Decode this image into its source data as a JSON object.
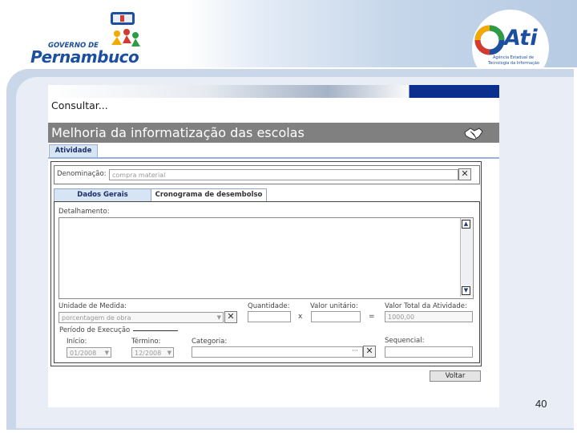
{
  "slide": {
    "page_number": "40",
    "logo_left": {
      "top_text": "GOVERNO DE",
      "main_text": "Pernambuco"
    },
    "logo_right": {
      "main_text": "Ati",
      "line1": "Agência Estadual de",
      "line2": "Tecnologia da Informação"
    }
  },
  "app": {
    "heading": "Consultar...",
    "title": "Melhoria da informatização das escolas",
    "tab_main": "Atividade",
    "denominacao": {
      "label": "Denominação:",
      "value": "compra material"
    },
    "subtabs": [
      "Dados Gerais",
      "Cronograma de desembolso"
    ],
    "detalhamento_label": "Detalhamento:",
    "unidade_medida": {
      "label": "Unidade de Medida:",
      "value": "porcentagem de obra"
    },
    "quantidade": {
      "label": "Quantidade:",
      "value": ""
    },
    "multiply_symbol": "x",
    "valor_unitario": {
      "label": "Valor unitário:",
      "value": ""
    },
    "equals_symbol": "=",
    "valor_total": {
      "label": "Valor Total da Atividade:",
      "value": "1000,00"
    },
    "periodo_label": "Período de Execução",
    "inicio": {
      "label": "Início:",
      "value": "01/2008"
    },
    "termino": {
      "label": "Término:",
      "value": "12/2008"
    },
    "categoria": {
      "label": "Categoria:",
      "value": ""
    },
    "sequencial": {
      "label": "Sequencial:",
      "value": ""
    },
    "voltar_label": "Voltar"
  },
  "colors": {
    "title_bar": "#808080",
    "tab_active": "#d6e4f4",
    "nav_dark": "#0a2f8d"
  },
  "icons": [
    "handshake-icon",
    "close-icon",
    "dropdown-arrow-icon",
    "scroll-up-icon",
    "scroll-down-icon",
    "ellipsis-icon"
  ]
}
